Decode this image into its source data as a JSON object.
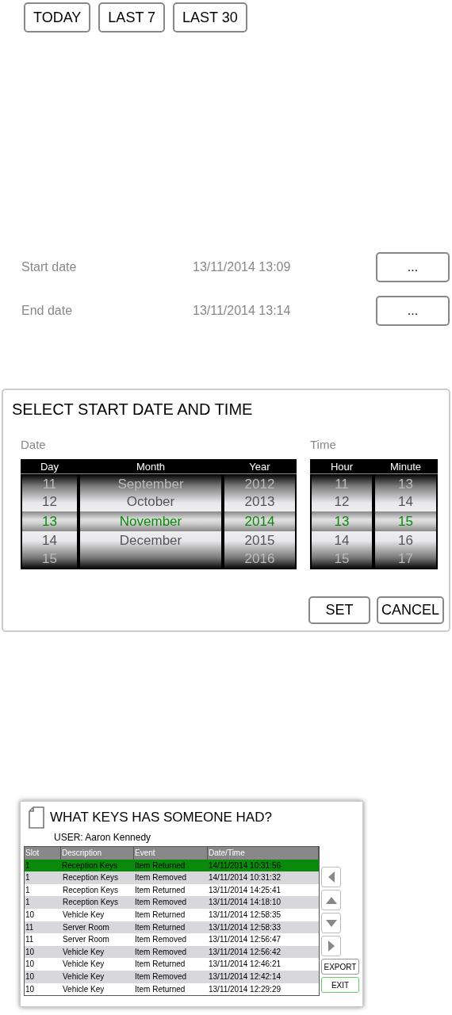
{
  "range_buttons": [
    "TODAY",
    "LAST 7",
    "LAST 30"
  ],
  "date_fields": [
    {
      "label": "Start date",
      "value": "13/11/2014 13:09",
      "button": "..."
    },
    {
      "label": "End date",
      "value": "13/11/2014 13:14",
      "button": "..."
    }
  ],
  "dialog": {
    "title": "SELECT START DATE AND TIME",
    "groups": [
      {
        "label": "Date",
        "columns": [
          {
            "header": "Day",
            "items": [
              {
                "text": "11",
                "selected": false
              },
              {
                "text": "12",
                "selected": false
              },
              {
                "text": "13",
                "selected": true
              },
              {
                "text": "14",
                "selected": false
              },
              {
                "text": "15",
                "selected": false
              }
            ]
          },
          {
            "header": "Month",
            "items": [
              {
                "text": "September",
                "selected": false
              },
              {
                "text": "October",
                "selected": false
              },
              {
                "text": "November",
                "selected": true
              },
              {
                "text": "December",
                "selected": false
              }
            ]
          },
          {
            "header": "Year",
            "items": [
              {
                "text": "2012",
                "selected": false
              },
              {
                "text": "2013",
                "selected": false
              },
              {
                "text": "2014",
                "selected": true
              },
              {
                "text": "2015",
                "selected": false
              },
              {
                "text": "2016",
                "selected": false
              }
            ]
          }
        ]
      },
      {
        "label": "Time",
        "columns": [
          {
            "header": "Hour",
            "items": [
              {
                "text": "11",
                "selected": false
              },
              {
                "text": "12",
                "selected": false
              },
              {
                "text": "13",
                "selected": true
              },
              {
                "text": "14",
                "selected": false
              },
              {
                "text": "15",
                "selected": false
              }
            ]
          },
          {
            "header": "Minute",
            "items": [
              {
                "text": "13",
                "selected": false
              },
              {
                "text": "14",
                "selected": false
              },
              {
                "text": "15",
                "selected": true
              },
              {
                "text": "16",
                "selected": false
              },
              {
                "text": "17",
                "selected": false
              }
            ]
          }
        ]
      }
    ],
    "buttons": [
      "SET",
      "CANCEL"
    ]
  },
  "report": {
    "title": "WHAT KEYS HAS SOMEONE HAD?",
    "user": "USER: Aaron Kennedy",
    "columns": [
      "Slot",
      "Description",
      "Event",
      "Date/Time"
    ],
    "rows": [
      {
        "cells": [
          "1",
          "Reception Keys",
          "Item Returned",
          "14/11/2014 10:31:56"
        ],
        "selected": true
      },
      {
        "cells": [
          "1",
          "Reception Keys",
          "Item Removed",
          "14/11/2014 10:31:32"
        ],
        "selected": false
      },
      {
        "cells": [
          "1",
          "Reception Keys",
          "Item Returned",
          "13/11/2014 14:25:41"
        ],
        "selected": false
      },
      {
        "cells": [
          "1",
          "Reception Keys",
          "Item Removed",
          "13/11/2014 14:18:10"
        ],
        "selected": false
      },
      {
        "cells": [
          "10",
          "Vehicle Key",
          "Item Returned",
          "13/11/2014 12:58:35"
        ],
        "selected": false
      },
      {
        "cells": [
          "11",
          "Server Room",
          "Item Returned",
          "13/11/2014 12:58:33"
        ],
        "selected": false
      },
      {
        "cells": [
          "11",
          "Server Room",
          "Item Removed",
          "13/11/2014 12:56:47"
        ],
        "selected": false
      },
      {
        "cells": [
          "10",
          "Vehicle Key",
          "Item Removed",
          "13/11/2014 12:56:42"
        ],
        "selected": false
      },
      {
        "cells": [
          "10",
          "Vehicle Key",
          "Item Returned",
          "13/11/2014 12:46:21"
        ],
        "selected": false
      },
      {
        "cells": [
          "10",
          "Vehicle Key",
          "Item Removed",
          "13/11/2014 12:42:14"
        ],
        "selected": false
      },
      {
        "cells": [
          "10",
          "Vehicle Key",
          "Item Returned",
          "13/11/2014 12:29:29"
        ],
        "selected": false
      }
    ],
    "nav": [
      {
        "kind": "left"
      },
      {
        "kind": "up"
      },
      {
        "kind": "down"
      },
      {
        "kind": "right"
      }
    ],
    "buttons": [
      {
        "label": "EXPORT",
        "kind": "normal"
      },
      {
        "label": "EXIT",
        "kind": "primary"
      }
    ]
  }
}
